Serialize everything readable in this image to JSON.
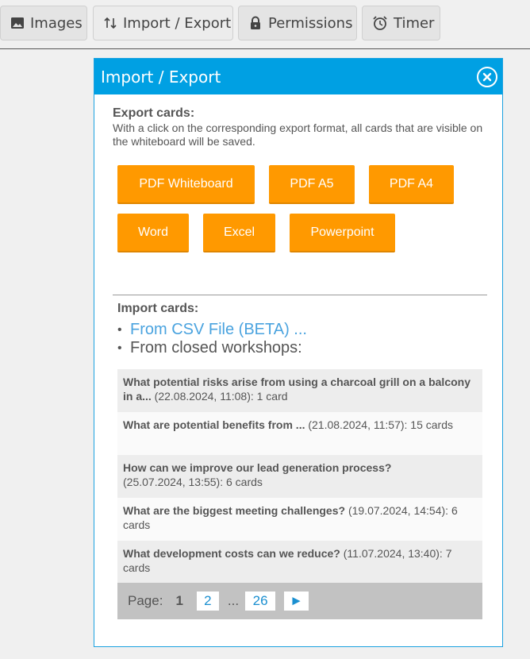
{
  "toolbar": {
    "images_label": "Images",
    "import_export_label": "Import / Export",
    "permissions_label": "Permissions",
    "timer_label": "Timer"
  },
  "dialog": {
    "title": "Import / Export",
    "export": {
      "title": "Export cards:",
      "description": "With a click on the corresponding export format, all cards that are visible on the whiteboard will be saved.",
      "buttons": [
        "PDF Whiteboard",
        "PDF A5",
        "PDF A4",
        "Word",
        "Excel",
        "Powerpoint"
      ]
    },
    "import": {
      "title": "Import cards:",
      "csv_link": "From CSV File (BETA) ...",
      "closed_workshops": "From closed workshops:"
    },
    "workshops": [
      {
        "title": "What potential risks arise from using a charcoal grill on a balcony in a...",
        "meta": " (22.08.2024, 11:08): 1 card"
      },
      {
        "title": "What are potential benefits from ...",
        "meta": " (21.08.2024, 11:57): 15 cards"
      },
      {
        "title": "How can we improve our lead generation process?",
        "meta": " (25.07.2024, 13:55): 6 cards"
      },
      {
        "title": "What are the biggest meeting challenges?",
        "meta": " (19.07.2024, 14:54): 6 cards"
      },
      {
        "title": "What development costs can we reduce?",
        "meta": " (11.07.2024, 13:40): 7 cards"
      }
    ],
    "pagination": {
      "label": "Page:",
      "current": "1",
      "next_page": "2",
      "ellipsis": "...",
      "last_page": "26",
      "next_arrow": "►"
    }
  },
  "colors": {
    "accent": "#00a0e3",
    "button": "#ff9900",
    "link": "#4aa3df"
  }
}
